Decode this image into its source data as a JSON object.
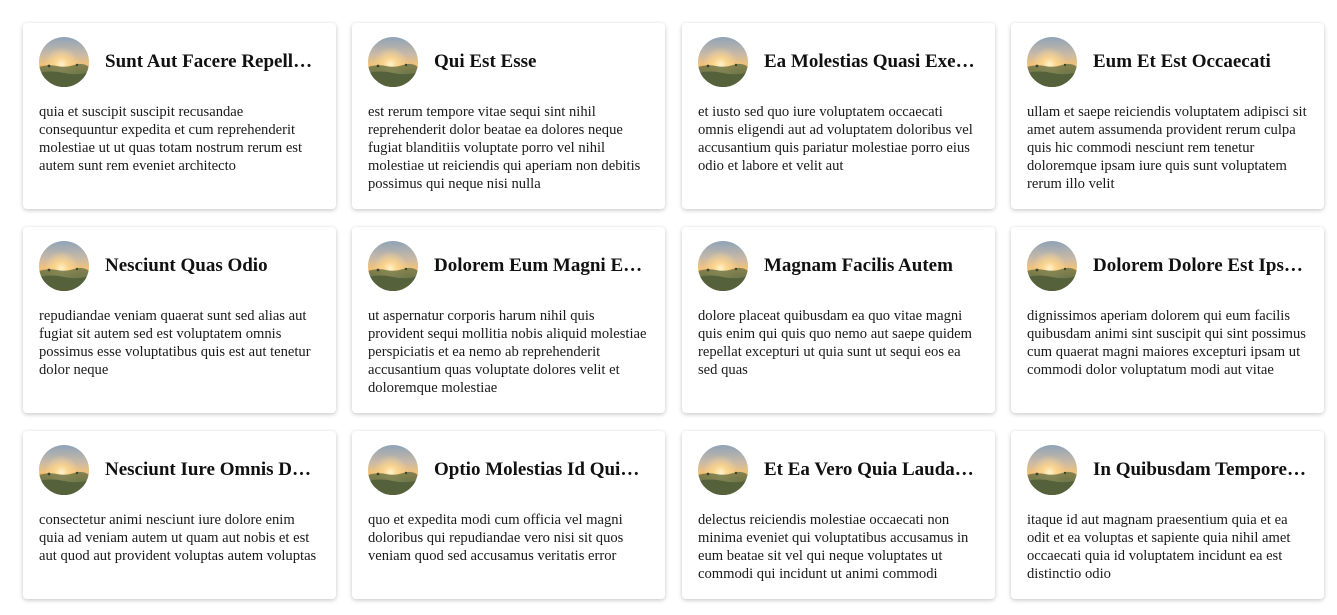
{
  "cards": [
    {
      "title": "Sunt Aut Facere Repellat Provident Occaecati",
      "body": "quia et suscipit suscipit recusandae consequuntur expedita et cum reprehenderit molestiae ut ut quas totam nostrum rerum est autem sunt rem eveniet architecto"
    },
    {
      "title": "Qui Est Esse",
      "body": "est rerum tempore vitae sequi sint nihil reprehenderit dolor beatae ea dolores neque fugiat blanditiis voluptate porro vel nihil molestiae ut reiciendis qui aperiam non debitis possimus qui neque nisi nulla"
    },
    {
      "title": "Ea Molestias Quasi Exercitationem",
      "body": "et iusto sed quo iure voluptatem occaecati omnis eligendi aut ad voluptatem doloribus vel accusantium quis pariatur molestiae porro eius odio et labore et velit aut"
    },
    {
      "title": "Eum Et Est Occaecati",
      "body": "ullam et saepe reiciendis voluptatem adipisci sit amet autem assumenda provident rerum culpa quis hic commodi nesciunt rem tenetur doloremque ipsam iure quis sunt voluptatem rerum illo velit"
    },
    {
      "title": "Nesciunt Quas Odio",
      "body": "repudiandae veniam quaerat sunt sed alias aut fugiat sit autem sed est voluptatem omnis possimus esse voluptatibus quis est aut tenetur dolor neque"
    },
    {
      "title": "Dolorem Eum Magni Eos Aperiam",
      "body": "ut aspernatur corporis harum nihil quis provident sequi mollitia nobis aliquid molestiae perspiciatis et ea nemo ab reprehenderit accusantium quas voluptate dolores velit et doloremque molestiae"
    },
    {
      "title": "Magnam Facilis Autem",
      "body": "dolore placeat quibusdam ea quo vitae magni quis enim qui quis quo nemo aut saepe quidem repellat excepturi ut quia sunt ut sequi eos ea sed quas"
    },
    {
      "title": "Dolorem Dolore Est Ipsam",
      "body": "dignissimos aperiam dolorem qui eum facilis quibusdam animi sint suscipit qui sint possimus cum quaerat magni maiores excepturi ipsam ut commodi dolor voluptatum modi aut vitae"
    },
    {
      "title": "Nesciunt Iure Omnis Dolorem",
      "body": "consectetur animi nesciunt iure dolore enim quia ad veniam autem ut quam aut nobis et est aut quod aut provident voluptas autem voluptas"
    },
    {
      "title": "Optio Molestias Id Quia Eum",
      "body": "quo et expedita modi cum officia vel magni doloribus qui repudiandae vero nisi sit quos veniam quod sed accusamus veritatis error"
    },
    {
      "title": "Et Ea Vero Quia Laudantium",
      "body": "delectus reiciendis molestiae occaecati non minima eveniet qui voluptatibus accusamus in eum beatae sit vel qui neque voluptates ut commodi qui incidunt ut animi commodi"
    },
    {
      "title": "In Quibusdam Tempore Odit",
      "body": "itaque id aut magnam praesentium quia et ea odit et ea voluptas et sapiente quia nihil amet occaecati quia id voluptatem incidunt ea est distinctio odio"
    }
  ],
  "avatar_icon": "landscape-sunset-avatar-icon",
  "colors": {
    "card_bg": "#ffffff",
    "title": "#111111",
    "body": "#1a1a1a"
  }
}
